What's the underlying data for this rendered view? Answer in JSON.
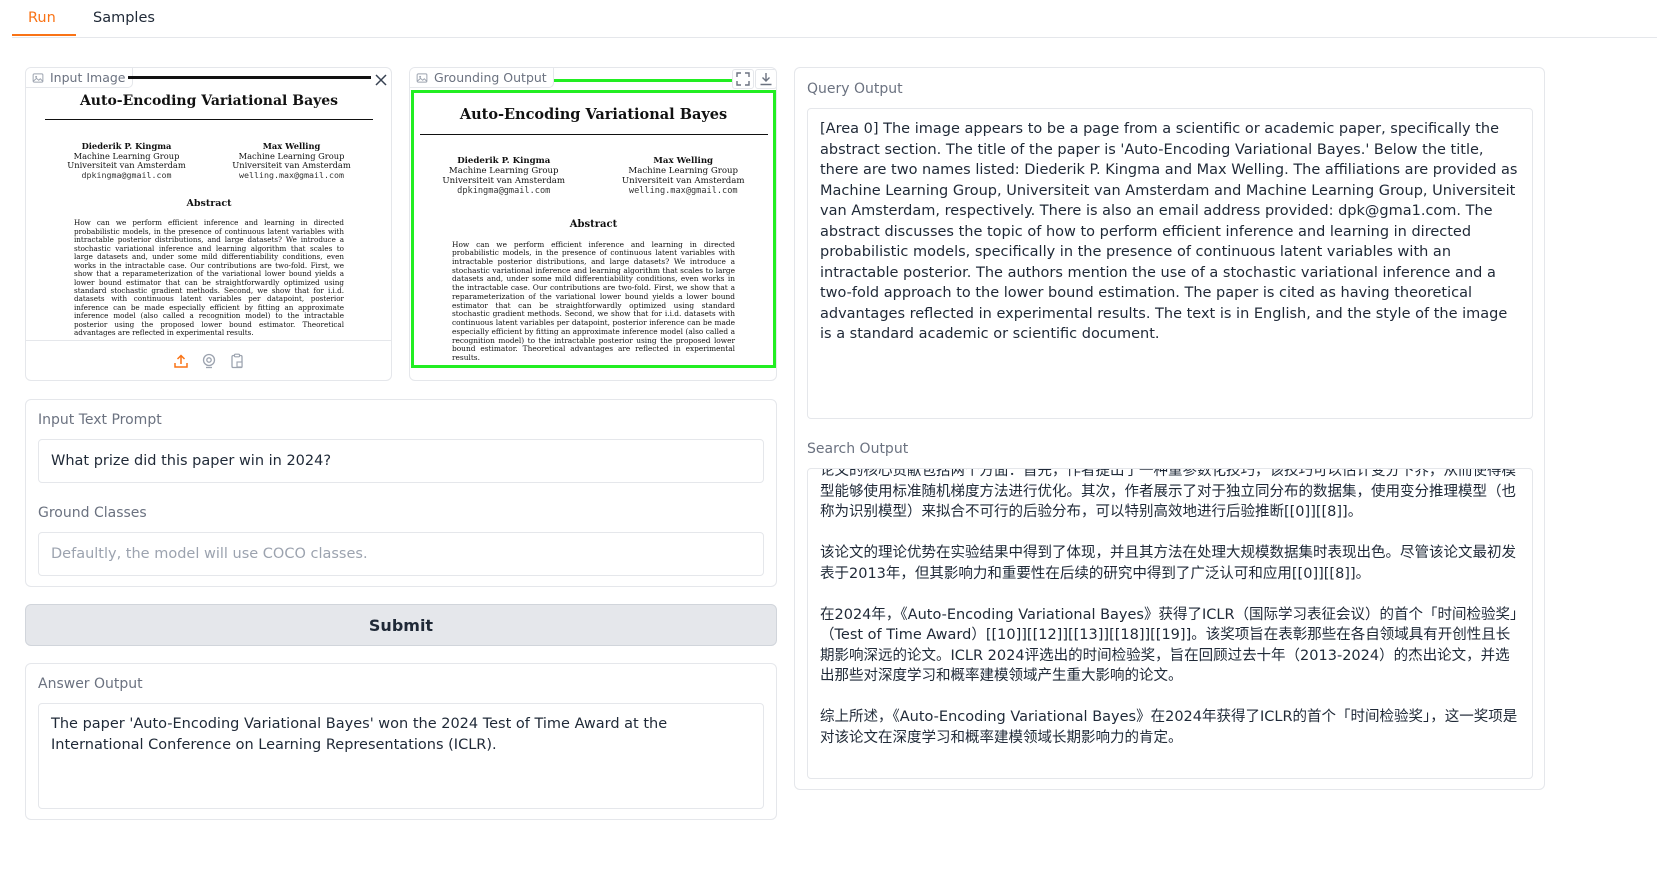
{
  "tabs": [
    {
      "label": "Run",
      "active": true
    },
    {
      "label": "Samples",
      "active": false
    }
  ],
  "input_image": {
    "label": "Input Image"
  },
  "grounding_output": {
    "label": "Grounding Output"
  },
  "paper": {
    "title": "Auto-Encoding Variational Bayes",
    "author1": {
      "name": "Diederik P. Kingma",
      "group": "Machine Learning Group",
      "uni": "Universiteit van Amsterdam",
      "email": "dpkingma@gmail.com"
    },
    "author2": {
      "name": "Max Welling",
      "group": "Machine Learning Group",
      "uni": "Universiteit van Amsterdam",
      "email": "welling.max@gmail.com"
    },
    "abstract_heading": "Abstract",
    "abstract_text": "How can we perform efficient inference and learning in directed probabilistic models, in the presence of continuous latent variables with intractable posterior distributions, and large datasets? We introduce a stochastic variational inference and learning algorithm that scales to large datasets and, under some mild differentiability conditions, even works in the intractable case. Our contributions are two-fold. First, we show that a reparameterization of the variational lower bound yields a lower bound estimator that can be straightforwardly optimized using standard stochastic gradient methods. Second, we show that for i.i.d. datasets with continuous latent variables per datapoint, posterior inference can be made especially efficient by fitting an approximate inference model (also called a recognition model) to the intractable posterior using the proposed lower bound estimator. Theoretical advantages are reflected in experimental results."
  },
  "prompt": {
    "label": "Input Text Prompt",
    "value": "What prize did this paper win in 2024?"
  },
  "ground_classes": {
    "label": "Ground Classes",
    "placeholder": "Defaultly, the model will use COCO classes."
  },
  "submit_label": "Submit",
  "answer_output": {
    "label": "Answer Output",
    "text": "The paper 'Auto-Encoding Variational Bayes' won the 2024 Test of Time Award at the International Conference on Learning Representations (ICLR)."
  },
  "query_output": {
    "label": "Query Output",
    "text": "[Area 0] The image appears to be a page from a scientific or academic paper, specifically the abstract section. The title of the paper is 'Auto-Encoding Variational Bayes.' Below the title, there are two names listed: Diederik P. Kingma and Max Welling. The affiliations are provided as Machine Learning Group, Universiteit van Amsterdam and Machine Learning Group, Universiteit van Amsterdam, respectively. There is also an email address provided: dpk@gma1.com. The abstract discusses the topic of how to perform efficient inference and learning in directed probabilistic models, specifically in the presence of continuous latent variables with an intractable posterior. The authors mention the use of a stochastic variational inference and a two-fold approach to the lower bound estimation. The paper is cited as having theoretical advantages reflected in experimental results. The text is in English, and the style of the image is a standard academic or scientific document."
  },
  "search_output": {
    "label": "Search Output",
    "paragraphs": [
      "论文的核心贡献包括两个方面：首先，作者提出了一种重参数化技巧，该技巧可以估计变分下界，从而使得模型能够使用标准随机梯度方法进行优化。其次，作者展示了对于独立同分布的数据集，使用变分推理模型（也称为识别模型）来拟合不可行的后验分布，可以特别高效地进行后验推断[[0]][[8]]。",
      "该论文的理论优势在实验结果中得到了体现，并且其方法在处理大规模数据集时表现出色。尽管该论文最初发表于2013年，但其影响力和重要性在后续的研究中得到了广泛认可和应用[[0]][[8]]。",
      "在2024年，《Auto-Encoding Variational Bayes》获得了ICLR（国际学习表征会议）的首个「时间检验奖」（Test of Time Award）[[10]][[12]][[13]][[18]][[19]]。该奖项旨在表彰那些在各自领域具有开创性且长期影响深远的论文。ICLR 2024评选出的时间检验奖，旨在回顾过去十年（2013-2024）的杰出论文，并选出那些对深度学习和概率建模领域产生重大影响的论文。",
      "综上所述，《Auto-Encoding Variational Bayes》在2024年获得了ICLR的首个「时间检验奖」，这一奖项是对该论文在深度学习和概率建模领域长期影响力的肯定。"
    ]
  },
  "colors": {
    "accent": "#f97316",
    "grounding_box": "#22ee22",
    "border": "#e5e7eb",
    "submit_bg": "#e5e7eb"
  }
}
